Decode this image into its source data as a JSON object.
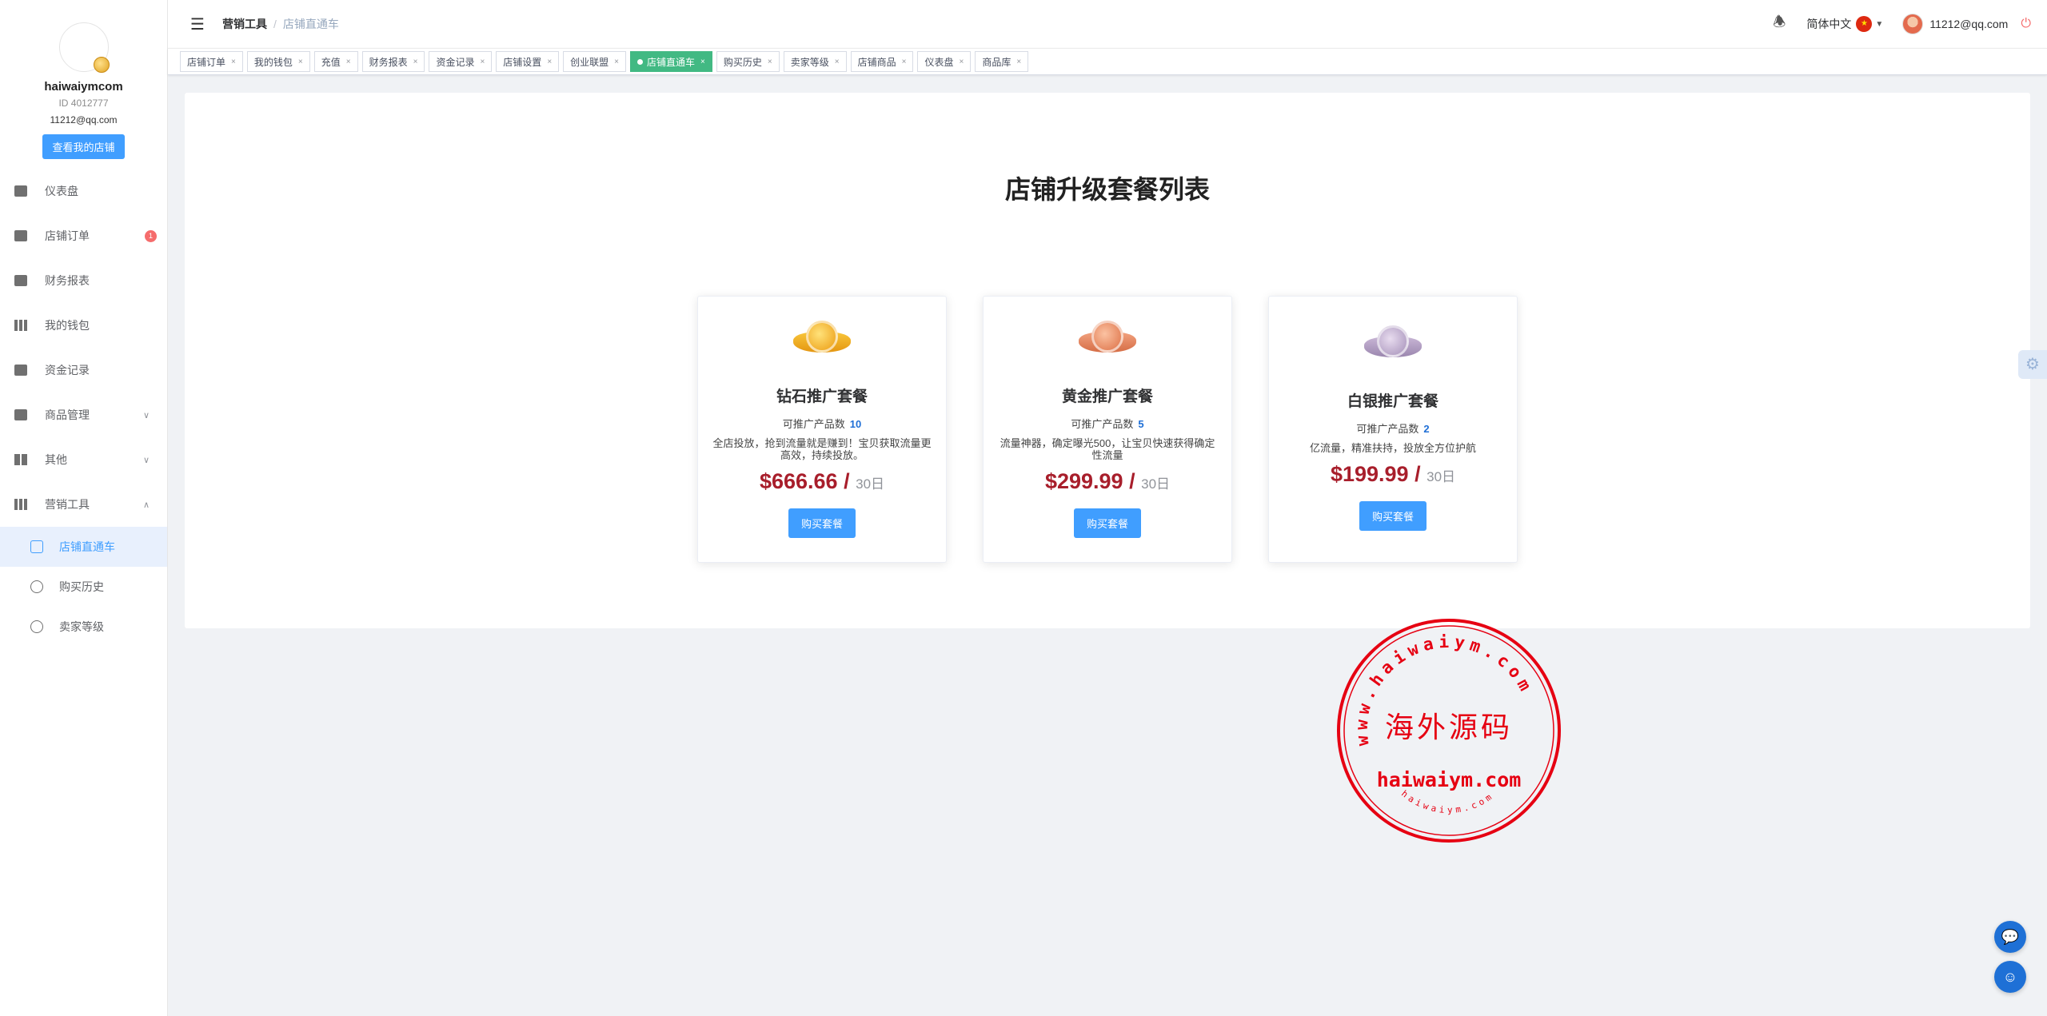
{
  "profile": {
    "username": "haiwaiymcom",
    "id_label": "ID 4012777",
    "email": "11212@qq.com",
    "shop_button": "查看我的店铺"
  },
  "menu": {
    "dashboard": "仪表盘",
    "orders": "店铺订单",
    "orders_badge": "1",
    "finance": "财务报表",
    "wallet": "我的钱包",
    "funds": "资金记录",
    "products": "商品管理",
    "other": "其他",
    "marketing": "营销工具",
    "sub": {
      "express": "店铺直通车",
      "history": "购买历史",
      "seller_level": "卖家等级"
    }
  },
  "header": {
    "breadcrumb_parent": "营销工具",
    "breadcrumb_current": "店铺直通车",
    "language": "简体中文",
    "user_email": "11212@qq.com"
  },
  "tags": [
    "店铺订单",
    "我的钱包",
    "充值",
    "财务报表",
    "资金记录",
    "店铺设置",
    "创业联盟",
    "店铺直通车",
    "购买历史",
    "卖家等级",
    "店铺商品",
    "仪表盘",
    "商品库"
  ],
  "active_tag_index": 7,
  "page": {
    "title": "店铺升级套餐列表"
  },
  "plans": [
    {
      "name": "钻石推广套餐",
      "count_label": "可推广产品数",
      "count": "10",
      "description": "全店投放，抢到流量就是赚到！宝贝获取流量更高效，持续投放。",
      "price": "$666.66",
      "slash": "/",
      "period": "30日",
      "button": "购买套餐",
      "medal": "gold-medal-icon"
    },
    {
      "name": "黄金推广套餐",
      "count_label": "可推广产品数",
      "count": "5",
      "description": "流量神器，确定曝光500，让宝贝快速获得确定性流量",
      "price": "$299.99",
      "slash": "/",
      "period": "30日",
      "button": "购买套餐",
      "medal": "bronze-medal-icon"
    },
    {
      "name": "白银推广套餐",
      "count_label": "可推广产品数",
      "count": "2",
      "description": "亿流量，精准扶持，投放全方位护航",
      "price": "$199.99",
      "slash": "/",
      "period": "30日",
      "button": "购买套餐",
      "medal": "silver-medal-icon"
    }
  ],
  "watermark": {
    "ring_text": "www.haiwaiym.com",
    "center_text": "海外源码",
    "domain_text": "haiwaiym.com",
    "bottom_text": "haiwaiym.com",
    "color": "#e60012"
  },
  "colors": {
    "primary": "#409eff",
    "active_tag": "#42b983",
    "price": "#a81e2b"
  }
}
